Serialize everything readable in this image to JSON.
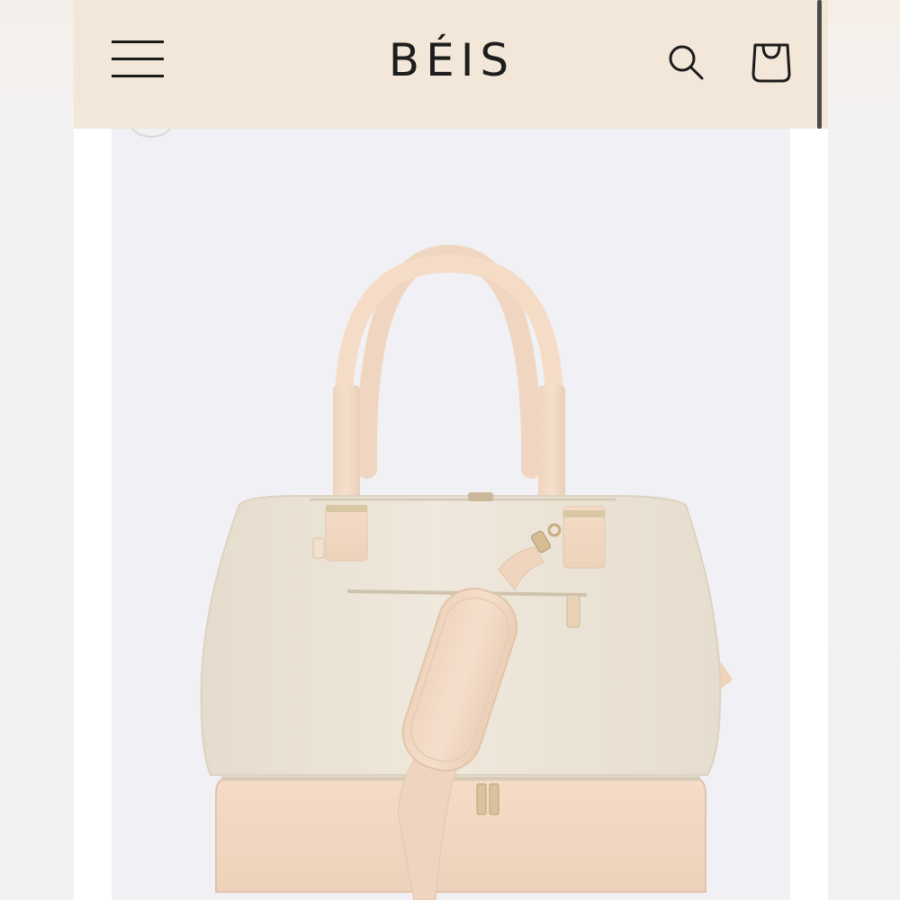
{
  "header": {
    "brand": "BÉIS",
    "menu_icon": "hamburger-menu-icon",
    "search_icon": "search-icon",
    "cart_icon": "shopping-bag-icon",
    "background_color": "#f3e7d9"
  },
  "product": {
    "image_subject": "weekender-bag-icon",
    "canvas_color": "#ece5d8",
    "leather_color": "#f2d7c0"
  }
}
